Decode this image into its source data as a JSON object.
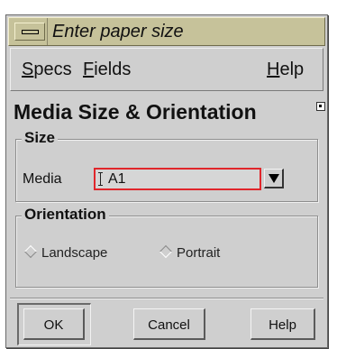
{
  "window": {
    "title": "Enter paper size"
  },
  "menubar": {
    "items": [
      {
        "label": "Specs",
        "mnemonic": "S",
        "rest": "pecs"
      },
      {
        "label": "Fields",
        "mnemonic": "F",
        "rest": "ields"
      },
      {
        "label": "Help",
        "mnemonic": "H",
        "rest": "elp"
      }
    ]
  },
  "heading": "Media Size & Orientation",
  "size_group": {
    "label": "Size",
    "media_label": "Media",
    "media_value": "A1"
  },
  "orientation_group": {
    "label": "Orientation",
    "options": [
      "Landscape",
      "Portrait"
    ],
    "selected": "Landscape"
  },
  "buttons": {
    "ok": "OK",
    "cancel": "Cancel",
    "help": "Help"
  },
  "colors": {
    "titlebar": "#c6c29a",
    "dialog_bg": "#cfcfcf",
    "focus_outline": "#e0262b"
  },
  "icons": {
    "window_menu": "window-menu-icon",
    "dropdown": "dropdown-arrow-icon"
  }
}
